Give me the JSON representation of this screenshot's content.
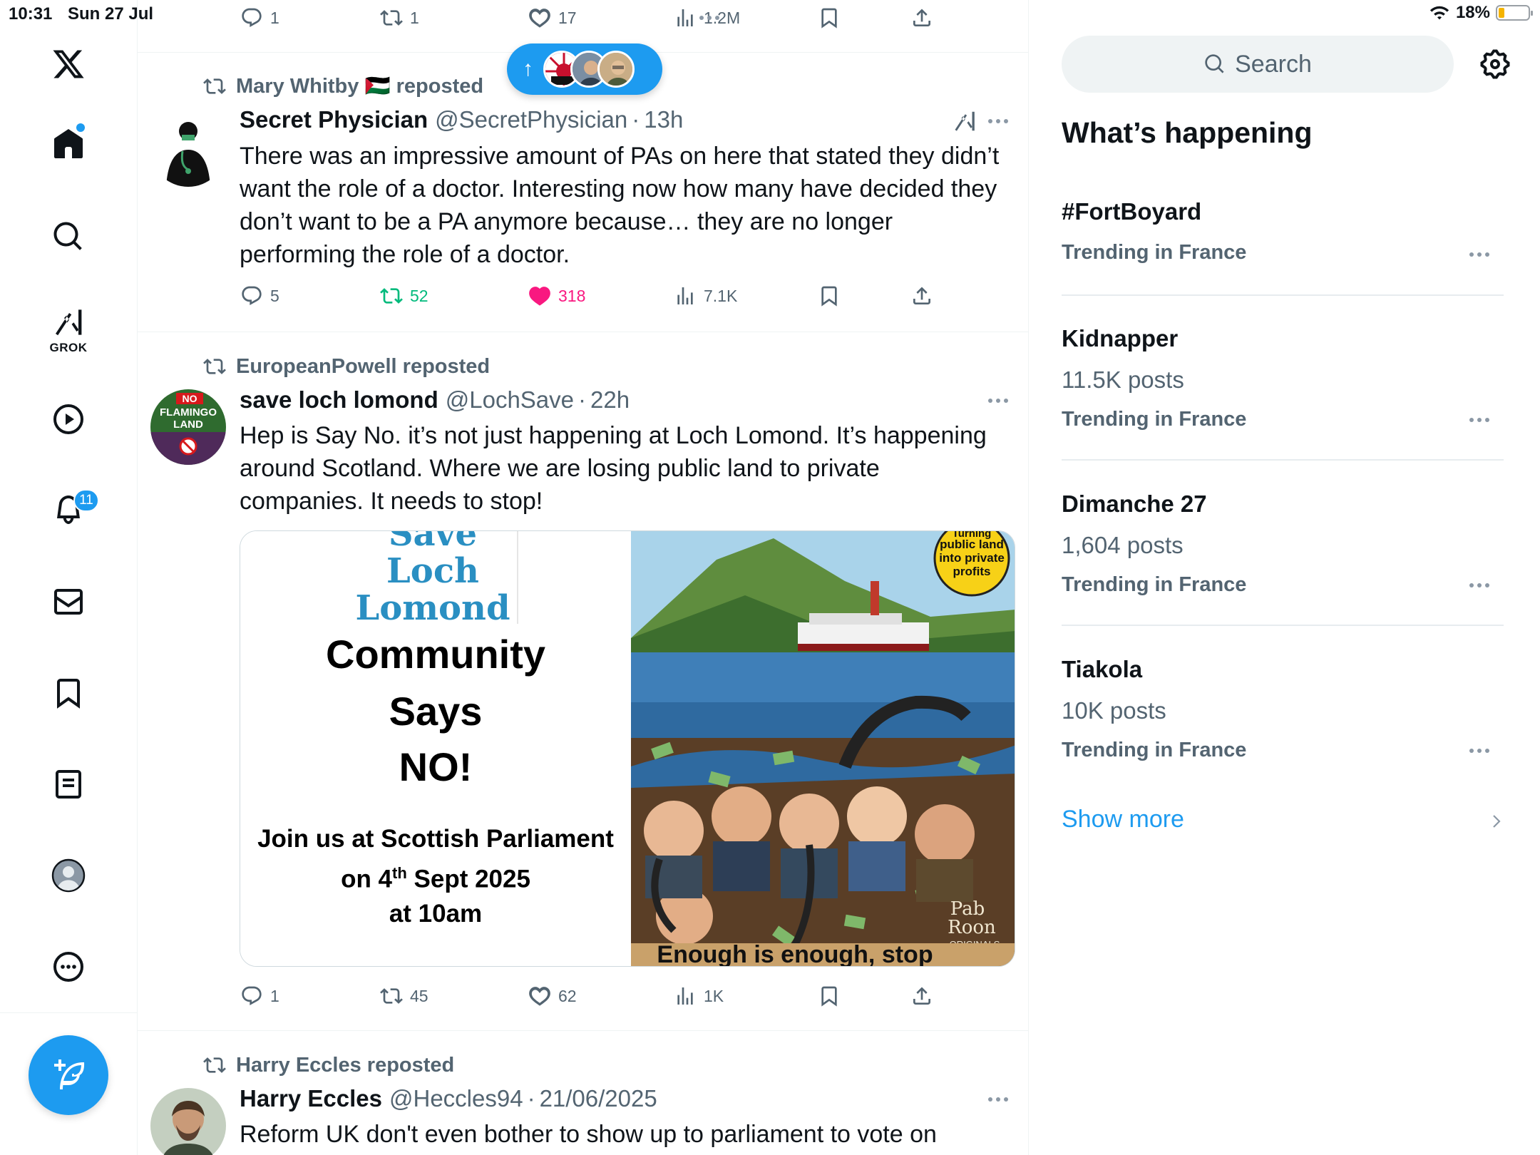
{
  "status_bar": {
    "time": "10:31",
    "date": "Sun 27 Jul",
    "battery": "18%"
  },
  "nav": {
    "grok_label": "GROK",
    "notifications_count": "11"
  },
  "new_posts_pill": {
    "arrow": "↑"
  },
  "top_actions": {
    "replies": "1",
    "reposts": "1",
    "likes": "17",
    "views": "1.2M"
  },
  "tweets": [
    {
      "reposted_by": "Mary Whitby 🇵🇸 reposted",
      "name": "Secret Physician",
      "handle": "@SecretPhysician",
      "sep": "·",
      "time": "13h",
      "text": "There was an impressive amount of PAs on here that stated they didn’t want the role of a doctor. Interesting now how many have decided they don’t want to be a PA anymore because… they are no longer performing the role of a doctor.",
      "replies": "5",
      "reposts": "52",
      "likes": "318",
      "views": "7.1K"
    },
    {
      "reposted_by": "EuropeanPowell reposted",
      "name": "save loch lomond",
      "handle": "@LochSave",
      "sep": "·",
      "time": "22h",
      "avatar_text": [
        "NO",
        "FLAMINGO",
        "LAND"
      ],
      "text": "Hep is Say No. it’s not just happening at Loch Lomond. It’s happening around Scotland. Where we are losing public land to private companies. It needs to stop!",
      "media": {
        "poster_save": "Save",
        "poster_loch": "Loch",
        "poster_lomond": "Lomond",
        "poster_line1": "Community",
        "poster_line2": "Says",
        "poster_line3": "NO!",
        "poster_join1": "Join us at Scottish Parliament",
        "poster_join2_pre": "on 4",
        "poster_join2_sup": "th",
        "poster_join2_post": " Sept 2025",
        "poster_join3": "at 10am",
        "art_badge": [
          "Turning",
          "public land",
          "into private",
          "profits"
        ],
        "art_sign": [
          "Pab",
          "Roon",
          "ORIGINALS"
        ],
        "art_caption": "Enough is enough, stop"
      },
      "replies": "1",
      "reposts": "45",
      "likes": "62",
      "views": "1K"
    },
    {
      "reposted_by": "Harry Eccles reposted",
      "name": "Harry Eccles",
      "handle": "@Heccles94",
      "sep": "·",
      "time": "21/06/2025",
      "text": "Reform UK don't even bother to show up to parliament to vote on"
    }
  ],
  "sidebar": {
    "search_placeholder": "Search",
    "section_title": "What’s happening",
    "trends": [
      {
        "name": "#FortBoyard",
        "posts": "",
        "context": "Trending in France"
      },
      {
        "name": "Kidnapper",
        "posts": "11.5K posts",
        "context": "Trending in France"
      },
      {
        "name": "Dimanche 27",
        "posts": "1,604 posts",
        "context": "Trending in France"
      },
      {
        "name": "Tiakola",
        "posts": "10K posts",
        "context": "Trending in France"
      }
    ],
    "show_more": "Show more"
  },
  "colors": {
    "accent": "#1d9bf0",
    "repost_green": "#00ba7c",
    "like_pink": "#f91880",
    "muted": "#536471"
  },
  "icons": [
    "x-logo-icon",
    "home-icon",
    "search-icon",
    "grok-icon",
    "video-icon",
    "bell-icon",
    "mail-icon",
    "bookmark-icon",
    "lists-icon",
    "profile-icon",
    "more-circle-icon",
    "compose-icon",
    "reply-icon",
    "repost-icon",
    "heart-icon",
    "views-icon",
    "share-icon",
    "gear-icon",
    "chevron-right-icon"
  ]
}
